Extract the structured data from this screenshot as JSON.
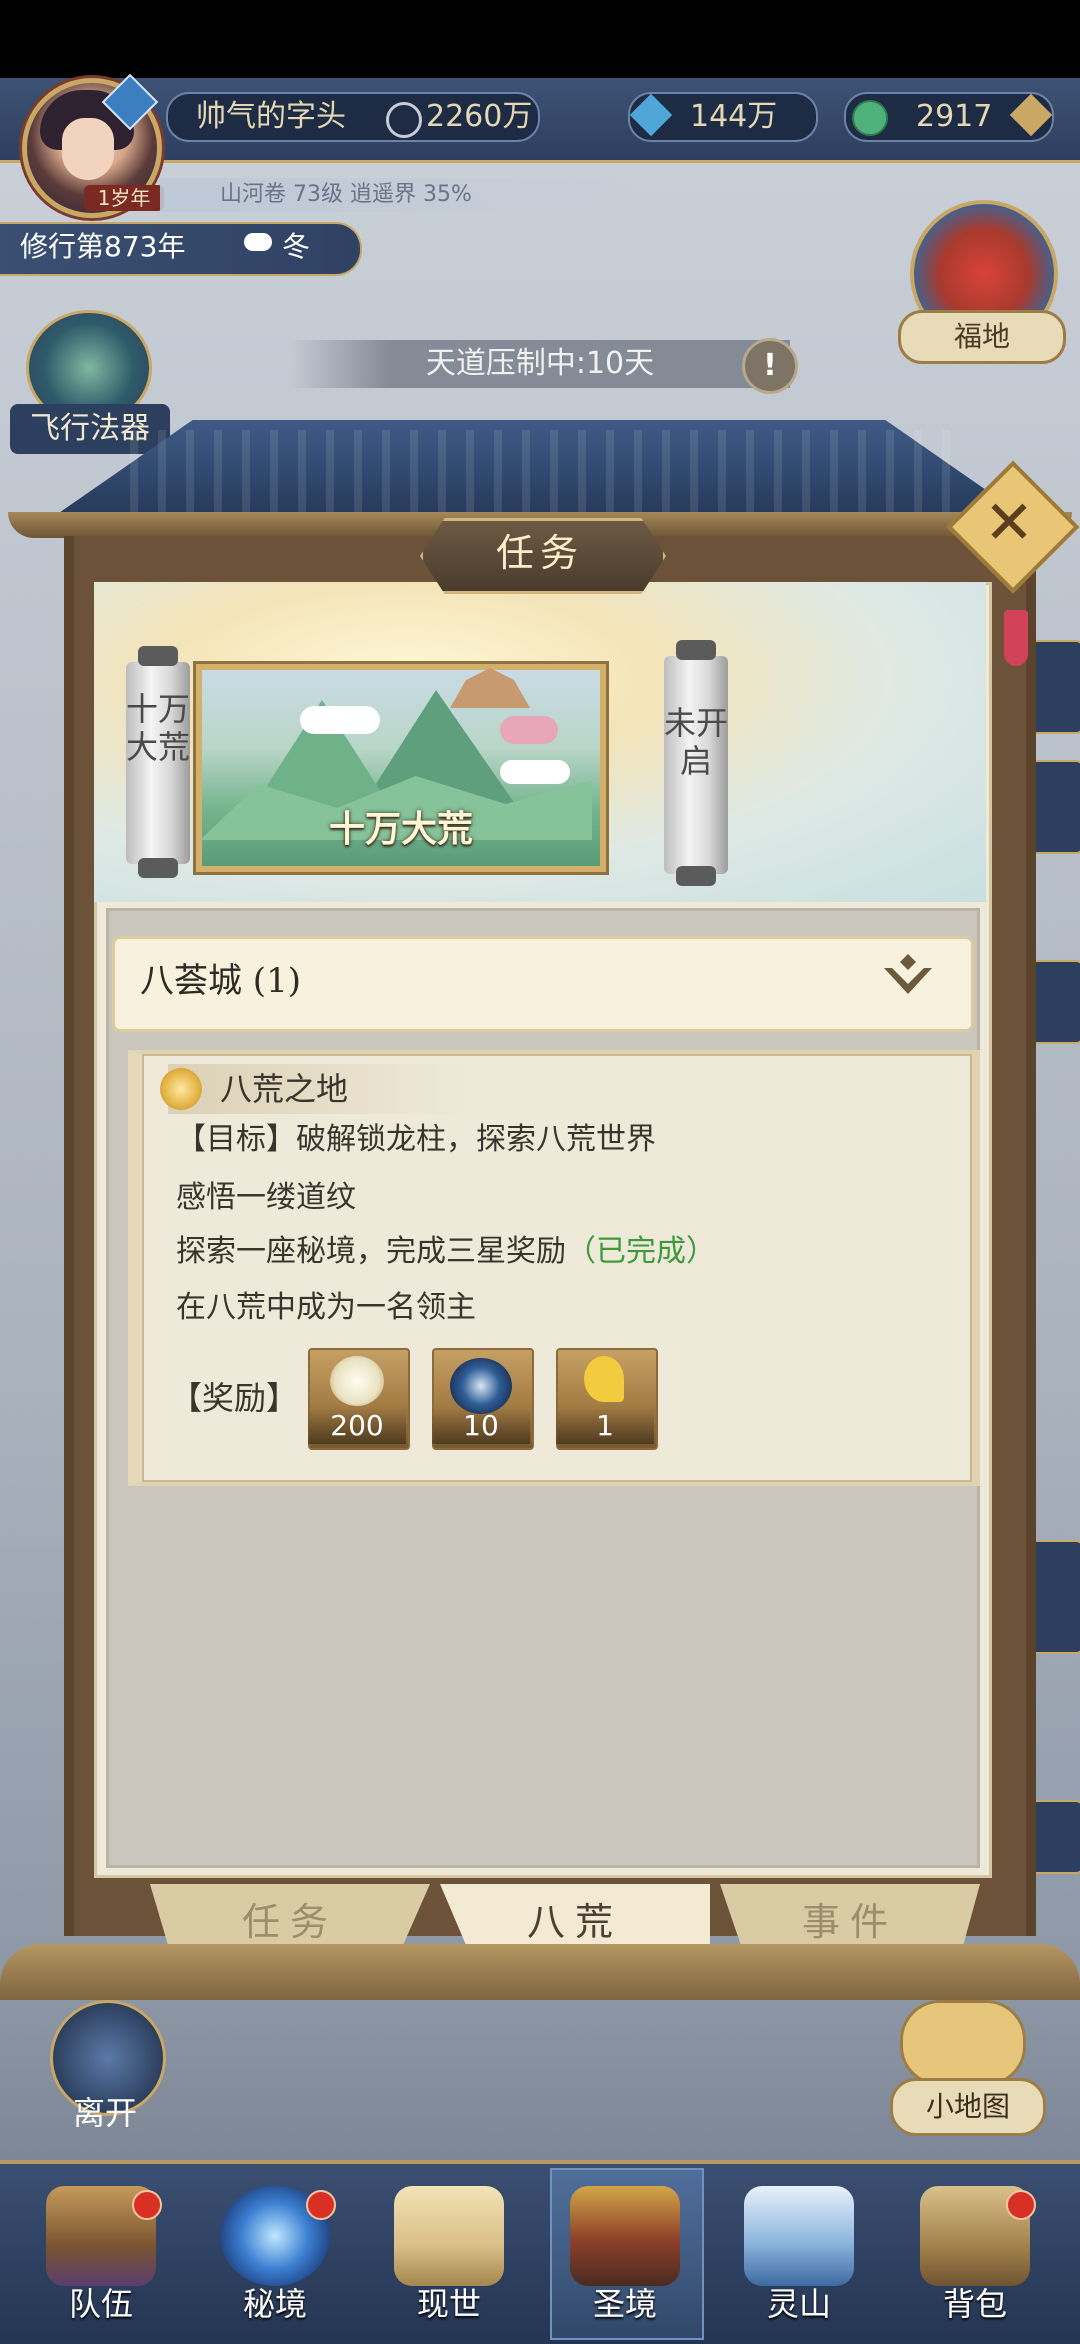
{
  "player": {
    "name": "帅气的字头",
    "power": "2260万",
    "age_tag": "1岁年",
    "sub_info": "山河卷 73级 逍遥界 35%",
    "year": "修行第873年",
    "season": "冬"
  },
  "currency": {
    "crystals": "144万",
    "jade": "2917"
  },
  "top_right": {
    "fudi_label": "福地"
  },
  "left_side": {
    "fly_label": "飞行法器"
  },
  "banner": {
    "suppression": "天道压制中:10天"
  },
  "panel": {
    "title": "任务",
    "regions": [
      {
        "label": "十万大荒",
        "state": "selected",
        "map_title": "十万大荒"
      },
      {
        "label": "未开启",
        "state": "locked"
      }
    ],
    "city": {
      "label": "八荟城 (1)"
    },
    "quest": {
      "title": "八荒之地",
      "objective": "【目标】破解锁龙柱，探索八荒世界",
      "steps": [
        {
          "text": "感悟一缕道纹",
          "status": ""
        },
        {
          "text": "探索一座秘境，完成三星奖励",
          "status": "（已完成）"
        },
        {
          "text": "在八荒中成为一名领主",
          "status": ""
        }
      ],
      "reward_label": "【奖励】",
      "rewards": [
        {
          "icon": "feather-icon",
          "count": "200"
        },
        {
          "icon": "bagua-orb-icon",
          "count": "10"
        },
        {
          "icon": "golden-dragon-icon",
          "count": "1"
        }
      ]
    },
    "tabs": [
      {
        "label": "任务",
        "selected": false
      },
      {
        "label": "八荒",
        "selected": true
      },
      {
        "label": "事件",
        "selected": false
      }
    ]
  },
  "map_controls": {
    "leave_label": "离开",
    "minimap_label": "小地图"
  },
  "bottom_nav": [
    {
      "label": "队伍",
      "icon": "team-icon",
      "badge": true
    },
    {
      "label": "秘境",
      "icon": "vortex-icon",
      "badge": true
    },
    {
      "label": "现世",
      "icon": "scroll-icon",
      "badge": false
    },
    {
      "label": "圣境",
      "icon": "palace-icon",
      "badge": false,
      "selected": true
    },
    {
      "label": "灵山",
      "icon": "mountain-icon",
      "badge": false
    },
    {
      "label": "背包",
      "icon": "bag-icon",
      "badge": true
    }
  ]
}
